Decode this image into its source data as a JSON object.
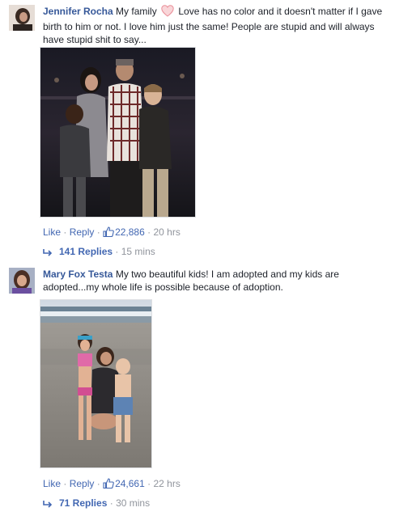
{
  "comments": [
    {
      "author": "Jennifer Rocha",
      "text_before_emoji": " My family ",
      "emoji": "heart-emoji",
      "text_after_emoji": " Love has no color and it doesn't matter if I gave birth to him or not. I love him just the same! People are stupid and will always have stupid shit to say...",
      "actions": {
        "like_label": "Like",
        "reply_label": "Reply",
        "like_count": "22,886",
        "time": "20 hrs"
      },
      "replies": {
        "label": "141 Replies",
        "time": "15 mins"
      }
    },
    {
      "author": "Mary Fox Testa",
      "text": " My two beautiful kids! I am adopted and my kids are adopted...my whole life is possible because of adoption.",
      "actions": {
        "like_label": "Like",
        "reply_label": "Reply",
        "like_count": "24,661",
        "time": "22 hrs"
      },
      "replies": {
        "label": "71 Replies",
        "time": "30 mins"
      }
    }
  ],
  "colors": {
    "link": "#4267b2",
    "author": "#365899",
    "meta": "#90949c",
    "heart": "#f3aeb4"
  },
  "separator": "·"
}
